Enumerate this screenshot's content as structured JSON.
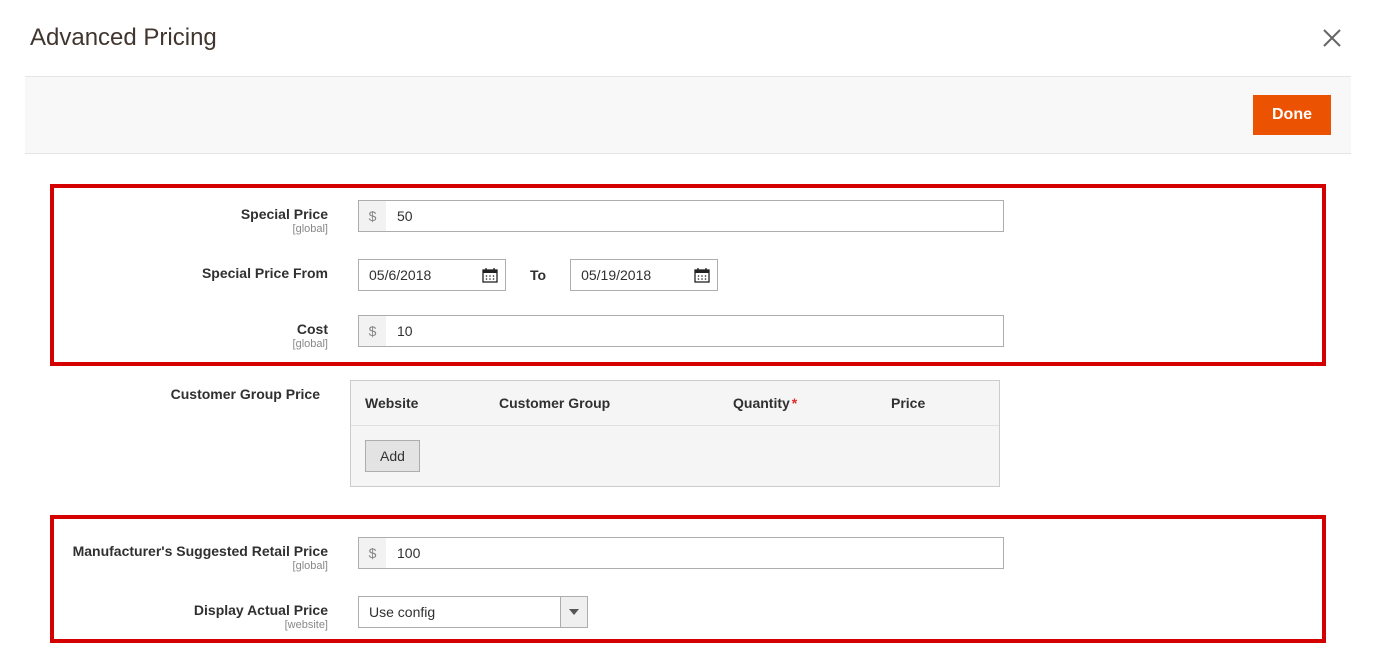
{
  "modal": {
    "title": "Advanced Pricing",
    "done_label": "Done"
  },
  "scopes": {
    "global": "[global]",
    "website": "[website]"
  },
  "labels": {
    "special_price": "Special Price",
    "special_price_from": "Special Price From",
    "to": "To",
    "cost": "Cost",
    "customer_group_price": "Customer Group Price",
    "msrp": "Manufacturer's Suggested Retail Price",
    "display_actual_price": "Display Actual Price",
    "add": "Add"
  },
  "currency_symbol": "$",
  "fields": {
    "special_price": "50",
    "special_from": "05/6/2018",
    "special_to": "05/19/2018",
    "cost": "10",
    "msrp": "100",
    "display_actual_price": "Use config"
  },
  "cgp_headers": {
    "website": "Website",
    "customer_group": "Customer Group",
    "quantity": "Quantity",
    "price": "Price"
  }
}
